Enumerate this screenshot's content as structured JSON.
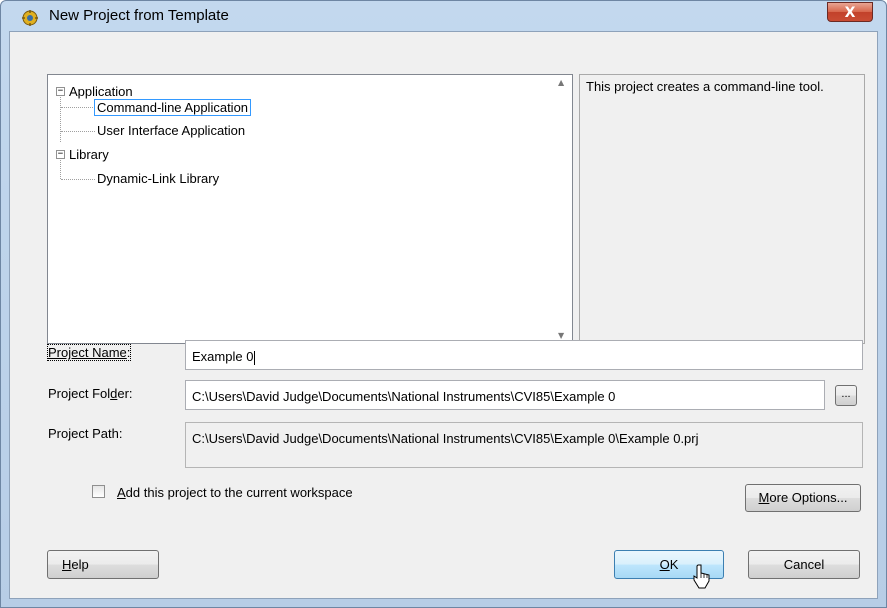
{
  "window": {
    "title": "New Project from Template",
    "close_label": "X"
  },
  "tree": {
    "items": [
      {
        "label": "Application",
        "expander": "−"
      },
      {
        "label": "Command-line Application"
      },
      {
        "label": "User Interface Application"
      },
      {
        "label": "Library",
        "expander": "−"
      },
      {
        "label": "Dynamic-Link Library"
      }
    ],
    "selected": "Command-line Application"
  },
  "description": "This project creates a command-line tool.",
  "form": {
    "project_name": {
      "label_underlined": "Project Name",
      "label_suffix": ":",
      "value": "Example 0"
    },
    "project_folder": {
      "label_prefix": "Project Fol",
      "label_underlined": "d",
      "label_suffix": "er:",
      "value": "C:\\Users\\David Judge\\Documents\\National Instruments\\CVI85\\Example 0",
      "browse_label": "..."
    },
    "project_path": {
      "label": "Project Path:",
      "value": "C:\\Users\\David Judge\\Documents\\National Instruments\\CVI85\\Example 0\\Example 0.prj"
    }
  },
  "checkbox": {
    "label_underlined": "A",
    "label_rest": "dd this project to the current workspace",
    "checked": false
  },
  "buttons": {
    "more_options": {
      "underlined": "M",
      "rest": "ore Options..."
    },
    "help": {
      "underlined": "H",
      "rest": "elp"
    },
    "ok": {
      "underlined": "O",
      "rest": "K"
    },
    "cancel": {
      "label": "Cancel"
    }
  },
  "colors": {
    "title_bar": "#c3d8ee",
    "close_button": "#c94c34",
    "dialog_bg": "#f0f0f0",
    "selection_border": "#3399ff",
    "ok_button": "#bee6fd"
  }
}
